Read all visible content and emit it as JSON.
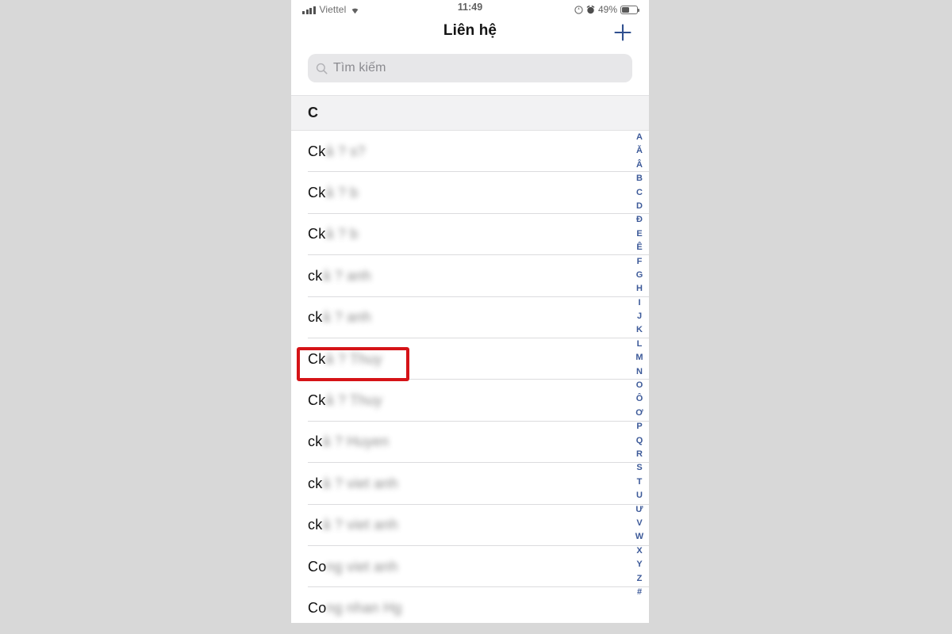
{
  "status_bar": {
    "carrier": "Viettel",
    "time": "11:49",
    "battery_percent": "49%",
    "wifi_icon": "wifi-icon",
    "signal_icon": "cellular-signal-icon",
    "location_icon": "location-arrow-icon",
    "alarm_icon": "alarm-clock-icon",
    "battery_icon": "battery-icon"
  },
  "nav": {
    "title": "Liên hệ",
    "add_icon": "plus-icon"
  },
  "search": {
    "placeholder": "Tìm kiếm",
    "value": "",
    "icon": "search-icon"
  },
  "section": {
    "header": "C"
  },
  "contacts": [
    {
      "visible": "Ck",
      "masked": "ả ? s?"
    },
    {
      "visible": "Ck",
      "masked": "ả ? b"
    },
    {
      "visible": "Ck",
      "masked": "ả ? b"
    },
    {
      "visible": "ck",
      "masked": "ả ? anh"
    },
    {
      "visible": "ck",
      "masked": "ả ? anh"
    },
    {
      "visible": "Ck",
      "masked": "ả ? Thuy"
    },
    {
      "visible": "Ck",
      "masked": "ả ? Thuy"
    },
    {
      "visible": "ck",
      "masked": "ả ? Huyen"
    },
    {
      "visible": "ck",
      "masked": "ả ? viet anh"
    },
    {
      "visible": "ck",
      "masked": "ả ? viet anh"
    },
    {
      "visible": "Co",
      "masked": "ng viet anh"
    },
    {
      "visible": "Co",
      "masked": "ng nhan Hg"
    }
  ],
  "highlighted_contact_index": 5,
  "alphabet_index": [
    "A",
    "Ă",
    "Â",
    "B",
    "C",
    "D",
    "Đ",
    "E",
    "Ê",
    "F",
    "G",
    "H",
    "I",
    "J",
    "K",
    "L",
    "M",
    "N",
    "O",
    "Ô",
    "Ơ",
    "P",
    "Q",
    "R",
    "S",
    "T",
    "U",
    "Ư",
    "V",
    "W",
    "X",
    "Y",
    "Z",
    "#"
  ],
  "colors": {
    "accent_blue": "#3d5a99",
    "highlight_red": "#d51317",
    "page_background": "#d8d8d8",
    "section_header_background": "#f2f2f3",
    "search_field_background": "#e7e7e9"
  }
}
